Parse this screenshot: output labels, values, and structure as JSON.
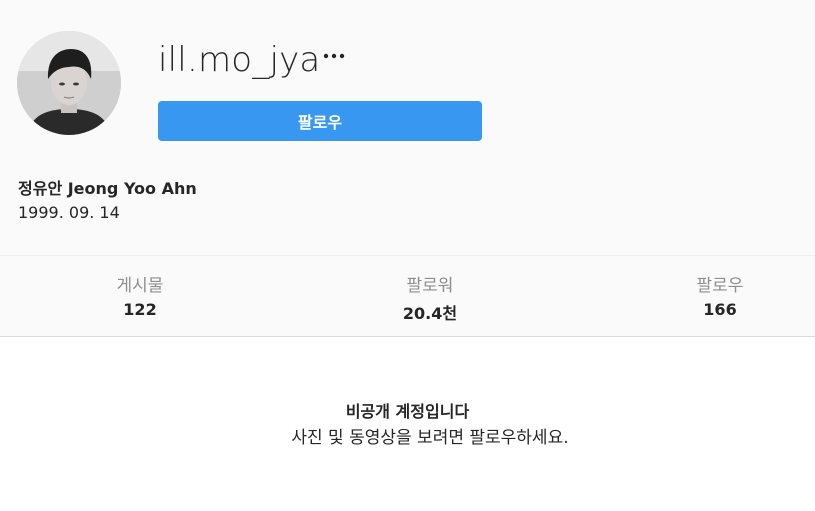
{
  "profile": {
    "username": "ill.mo_jya",
    "more_icon": "more-horizontal-icon",
    "follow_label": "팔로우",
    "full_name": "정유안 Jeong Yoo Ahn",
    "bio": "1999. 09. 14",
    "accent_color": "#3897f0"
  },
  "stats": {
    "posts": {
      "label": "게시물",
      "value": "122"
    },
    "followers": {
      "label": "팔로워",
      "value": "20.4천"
    },
    "following": {
      "label": "팔로우",
      "value": "166"
    }
  },
  "private_notice": {
    "title": "비공개 계정입니다",
    "description": "사진 및 동영상을 보려면 팔로우하세요."
  }
}
